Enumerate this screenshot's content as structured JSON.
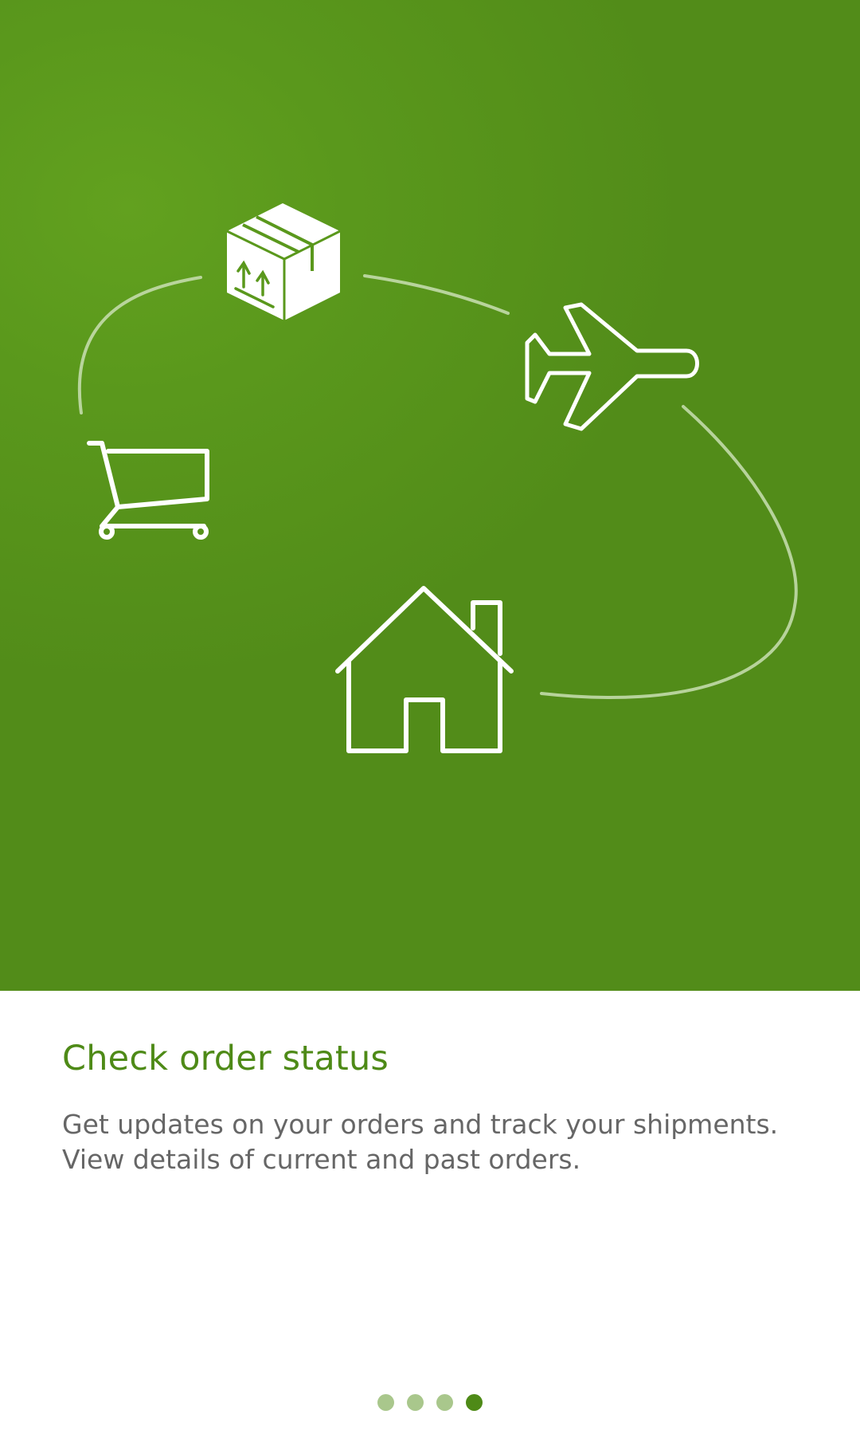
{
  "illustration": {
    "icons": [
      "package-icon",
      "airplane-icon",
      "shopping-cart-icon",
      "house-icon"
    ],
    "background_color": "#5a981c",
    "line_color": "#ffffff"
  },
  "onboarding": {
    "title": "Check order status",
    "description_lines": [
      "Get updates on your orders and track your shipments.",
      "View details of current and past orders."
    ]
  },
  "pager": {
    "page_count": 4,
    "current_page": 4,
    "active_color": "#4e8a17",
    "inactive_color": "#a9c78c"
  }
}
